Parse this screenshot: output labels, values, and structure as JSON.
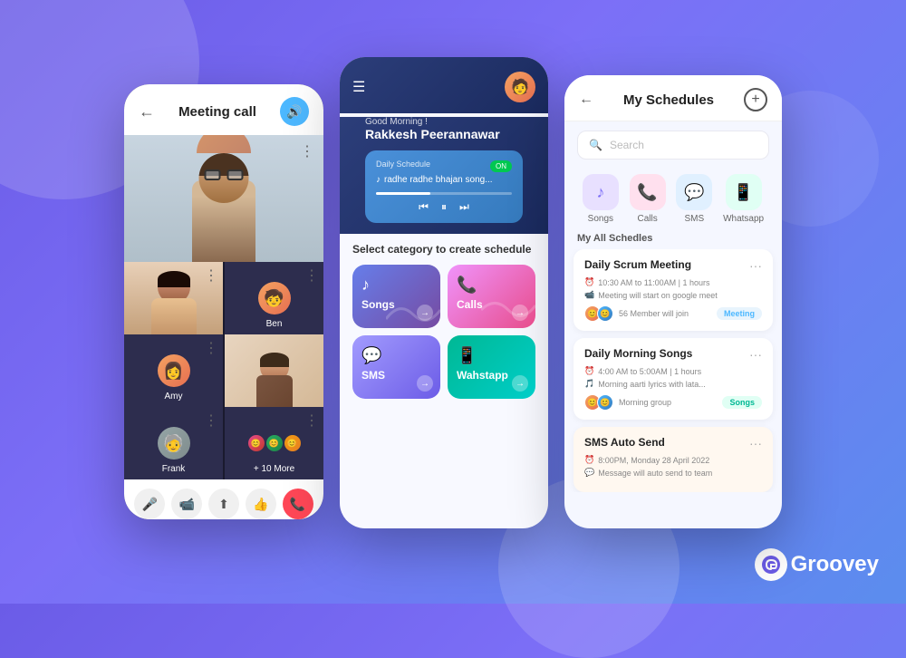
{
  "background": {
    "gradient": "linear-gradient(135deg, #6b5ce7, #5b8dee)"
  },
  "phone1": {
    "title": "Meeting call",
    "participants": [
      {
        "name": "Man with glasses",
        "type": "large"
      },
      {
        "name": "Woman",
        "type": "small-light"
      },
      {
        "name": "Ben",
        "label": "Ben",
        "type": "small-dark"
      },
      {
        "name": "Amy",
        "label": "Amy",
        "type": "small-dark"
      },
      {
        "name": "Man2",
        "type": "small-light"
      },
      {
        "name": "Frank",
        "label": "Frank",
        "type": "small-dark"
      },
      {
        "name": "More",
        "label": "+ 10 More",
        "type": "small-dark"
      }
    ],
    "controls": {
      "mic": "🎤",
      "video": "📹",
      "share": "⬆",
      "thumb": "👍",
      "end": "📞"
    }
  },
  "phone2": {
    "greeting": "Good Morning !",
    "user_name": "Rakkesh Peerannawar",
    "daily_schedule_label": "Daily Schedule",
    "song_title": "radhe radhe bhajan song...",
    "toggle_label": "ON",
    "section_title": "Select category to create schedule",
    "categories": [
      {
        "name": "Songs",
        "icon": "♪",
        "color": "songs"
      },
      {
        "name": "Calls",
        "icon": "📞",
        "color": "calls"
      },
      {
        "name": "SMS",
        "icon": "💬",
        "color": "sms"
      },
      {
        "name": "Wahstapp",
        "icon": "📱",
        "color": "wahstapp"
      }
    ]
  },
  "phone3": {
    "title": "My Schedules",
    "search_placeholder": "Search",
    "categories": [
      {
        "name": "Songs",
        "icon": "♪",
        "color": "purple"
      },
      {
        "name": "Calls",
        "icon": "📞",
        "color": "pink"
      },
      {
        "name": "SMS",
        "icon": "💬",
        "color": "blue"
      },
      {
        "name": "Whatsapp",
        "icon": "📱",
        "color": "green"
      }
    ],
    "all_schedules_label": "My All Schedles",
    "schedules": [
      {
        "title": "Daily Scrum Meeting",
        "time": "10:30 AM to 11:00AM | 1 hours",
        "desc": "Meeting will start on google meet",
        "members": "56 Member will join",
        "tag": "Meeting",
        "tag_color": "meeting",
        "time_icon": "⏰",
        "desc_icon": "📹"
      },
      {
        "title": "Daily Morning Songs",
        "time": "4:00 AM to 5:00AM | 1 hours",
        "desc": "Morning aarti lyrics with lata...",
        "members": "Morning group",
        "tag": "Songs",
        "tag_color": "songs",
        "time_icon": "⏰",
        "desc_icon": "🎵"
      },
      {
        "title": "SMS Auto Send",
        "time": "8:00PM, Monday 28 April 2022",
        "desc": "Message will auto send to team",
        "members": "",
        "tag": "",
        "tag_color": "",
        "time_icon": "⏰",
        "desc_icon": "💬"
      }
    ]
  },
  "logo": {
    "text": "Groovey",
    "letter": "G"
  }
}
